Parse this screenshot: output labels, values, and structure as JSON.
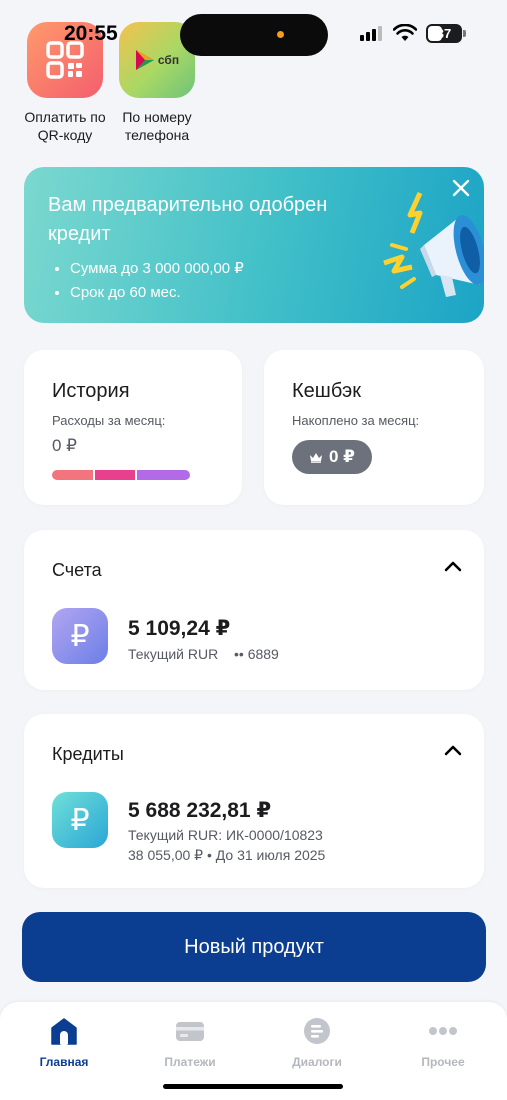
{
  "status": {
    "time": "20:55",
    "battery": "37"
  },
  "quick_actions": [
    {
      "label_line1": "Оплатить по",
      "label_line2": "QR-коду"
    },
    {
      "label_line1": "По номеру",
      "label_line2": "телефона",
      "logo_text": "сбп"
    }
  ],
  "banner": {
    "title": "Вам предварительно одобрен кредит",
    "bullets": [
      "Сумма до 3 000 000,00 ₽",
      "Срок до 60 мес."
    ]
  },
  "history": {
    "title": "История",
    "subtitle": "Расходы за месяц:",
    "amount": "0 ₽",
    "segment_colors": [
      "#f2757e",
      "#e8408d",
      "#b36ae6"
    ]
  },
  "cashback": {
    "title": "Кешбэк",
    "subtitle": "Накоплено за месяц:",
    "amount": "0 ₽"
  },
  "accounts": {
    "title": "Счета",
    "items": [
      {
        "amount": "5 109,24 ₽",
        "type": "Текущий RUR",
        "mask": "•• 6889"
      }
    ]
  },
  "credits": {
    "title": "Кредиты",
    "items": [
      {
        "amount": "5 688 232,81 ₽",
        "line1": "Текущий RUR: ИК-0000/10823",
        "line2": "38 055,00 ₽ • До 31 июля 2025"
      }
    ]
  },
  "new_product_label": "Новый продукт",
  "tabs": [
    {
      "label": "Главная",
      "icon": "home-icon",
      "active": true
    },
    {
      "label": "Платежи",
      "icon": "card-icon",
      "active": false
    },
    {
      "label": "Диалоги",
      "icon": "chat-icon",
      "active": false
    },
    {
      "label": "Прочее",
      "icon": "more-icon",
      "active": false
    }
  ],
  "colors": {
    "brand": "#0b3d91",
    "banner": "#40bfc8",
    "inactive_tab": "#b4b7bd"
  }
}
